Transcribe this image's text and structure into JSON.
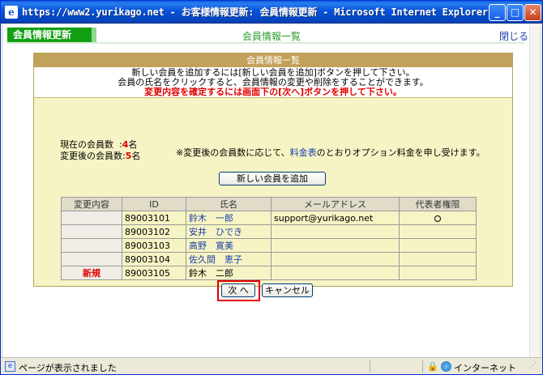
{
  "window": {
    "title": "https://www2.yurikago.net - お客様情報更新: 会員情報更新 - Microsoft Internet Explorer",
    "minimize_glyph": "_",
    "maximize_glyph": "□",
    "close_glyph": "✕"
  },
  "header": {
    "app_tab": "会員情報更新",
    "center_title": "会員情報一覧",
    "close_link": "閉じる"
  },
  "panel": {
    "title": "会員情報一覧",
    "notice_line1": "新しい会員を追加するには[新しい会員を追加]ボタンを押して下さい。",
    "notice_line2": "会員の氏名をクリックすると、会員情報の変更や削除をすることができます。",
    "notice_warning": "変更内容を確定するには画面下の[次へ]ボタンを押して下さい。",
    "current_count_label": "現在の会員数",
    "current_count_value": "4",
    "count_unit": "名",
    "changed_count_label": "変更後の会員数:",
    "changed_count_value": "5",
    "option_note_prefix": "※変更後の会員数に応じて、",
    "option_note_link": "料金表",
    "option_note_suffix": "のとおりオプション料金を申し受けます。",
    "add_button": "新しい会員を追加",
    "next_button": "次 へ",
    "cancel_button": "キャンセル"
  },
  "table": {
    "columns": [
      "変更内容",
      "ID",
      "氏名",
      "メールアドレス",
      "代表者権限"
    ],
    "rows": [
      {
        "change": "",
        "id": "89003101",
        "name": "鈴木　一郎",
        "email": "support@yurikago.net",
        "representative": true
      },
      {
        "change": "",
        "id": "89003102",
        "name": "安井　ひでき",
        "email": "",
        "representative": false
      },
      {
        "change": "",
        "id": "89003103",
        "name": "高野　寛美",
        "email": "",
        "representative": false
      },
      {
        "change": "",
        "id": "89003104",
        "name": "佐久間　恵子",
        "email": "",
        "representative": false
      },
      {
        "change": "新規",
        "id": "89003105",
        "name": "鈴木　二郎",
        "email": "",
        "representative": false
      }
    ]
  },
  "statusbar": {
    "text": "ページが表示されました",
    "zone": "インターネット"
  },
  "colors": {
    "tab_green": "#12a012",
    "panel_header": "#c2a25a",
    "panel_bg": "#f6f4c4",
    "warning_red": "#e00000",
    "link_blue": "#1a3ea8"
  }
}
